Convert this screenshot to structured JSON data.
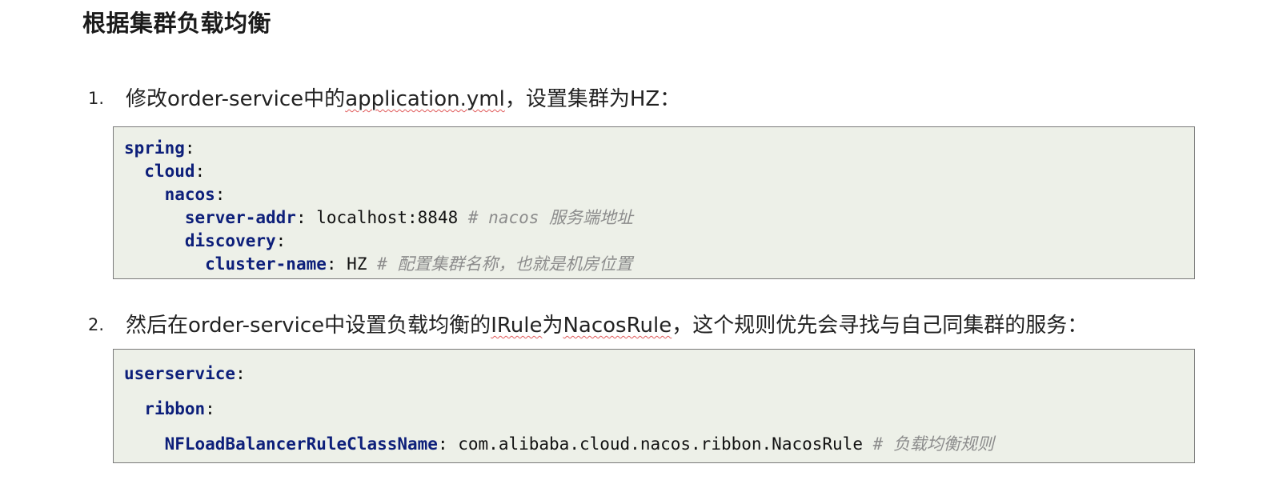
{
  "title": "根据集群负载均衡",
  "steps": [
    {
      "number": "1.",
      "text_a": "修改order-service中的",
      "text_underlined": "application.yml",
      "text_b": "，设置集群为HZ：",
      "code": [
        {
          "indent": "",
          "key": "spring",
          "sep": ":",
          "value": "",
          "comment": ""
        },
        {
          "indent": "  ",
          "key": "cloud",
          "sep": ":",
          "value": "",
          "comment": ""
        },
        {
          "indent": "    ",
          "key": "nacos",
          "sep": ":",
          "value": "",
          "comment": ""
        },
        {
          "indent": "      ",
          "key": "server-addr",
          "sep": ": ",
          "value": "localhost:8848 ",
          "comment": "# nacos 服务端地址"
        },
        {
          "indent": "      ",
          "key": "discovery",
          "sep": ":",
          "value": "",
          "comment": ""
        },
        {
          "indent": "        ",
          "key": "cluster-name",
          "sep": ": ",
          "value": "HZ ",
          "comment": "# 配置集群名称，也就是机房位置"
        }
      ]
    },
    {
      "number": "2.",
      "text_a": "然后在order-service中设置负载均衡的",
      "text_underlined": "IRule",
      "text_mid": "为",
      "text_underlined2": "NacosRule",
      "text_b": "，这个规则优先会寻找与自己同集群的服务：",
      "code": [
        {
          "indent": "",
          "key": "userservice",
          "sep": ":",
          "value": "",
          "comment": ""
        },
        {
          "indent": "  ",
          "key": "ribbon",
          "sep": ":",
          "value": "",
          "comment": ""
        },
        {
          "indent": "    ",
          "key": "NFLoadBalancerRuleClassName",
          "sep": ": ",
          "value": "com.alibaba.cloud.nacos.ribbon.NacosRule ",
          "comment": "# 负载均衡规则"
        }
      ]
    }
  ]
}
